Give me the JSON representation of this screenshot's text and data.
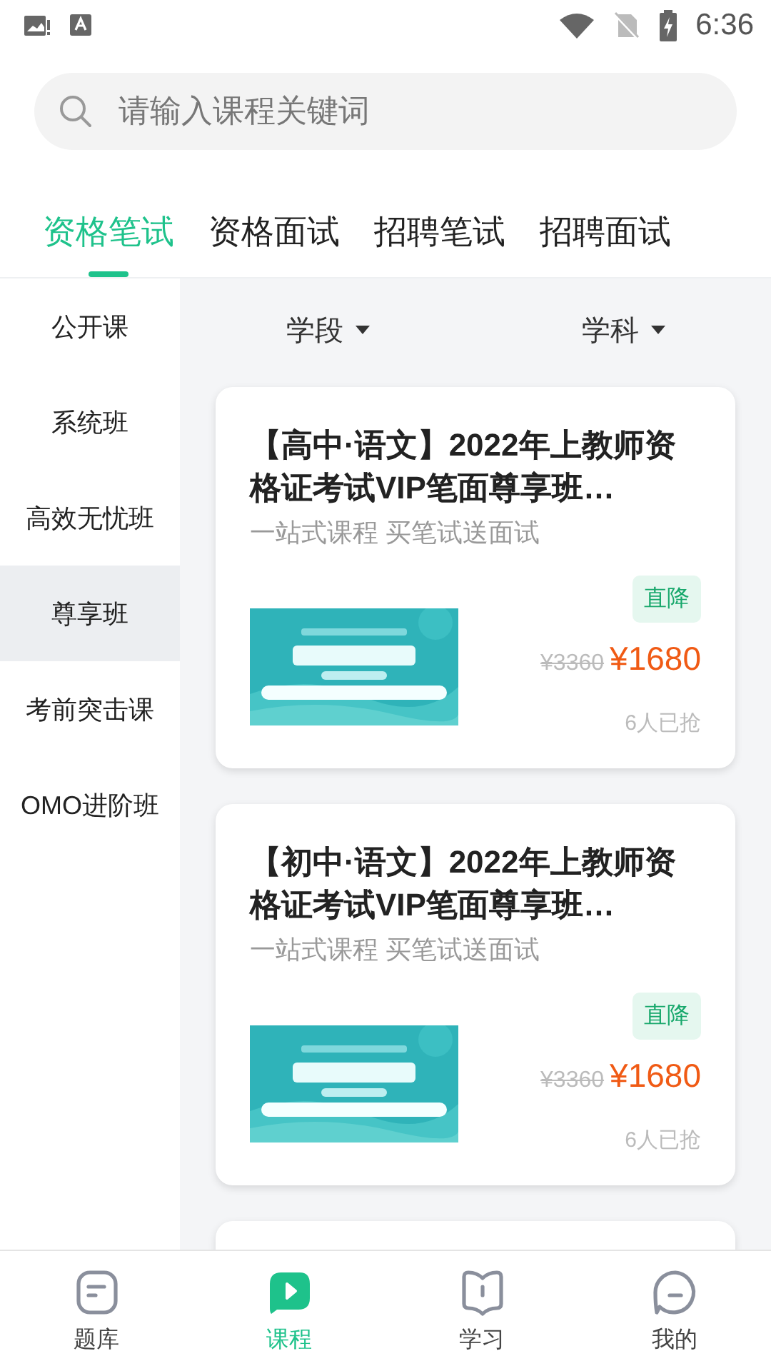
{
  "status_bar": {
    "time": "6:36"
  },
  "search": {
    "placeholder": "请输入课程关键词"
  },
  "tabs": [
    {
      "label": "资格笔试",
      "selected": true
    },
    {
      "label": "资格面试",
      "selected": false
    },
    {
      "label": "招聘笔试",
      "selected": false
    },
    {
      "label": "招聘面试",
      "selected": false
    }
  ],
  "sidebar": {
    "items": [
      {
        "label": "公开课",
        "selected": false
      },
      {
        "label": "系统班",
        "selected": false
      },
      {
        "label": "高效无忧班",
        "selected": false
      },
      {
        "label": "尊享班",
        "selected": true
      },
      {
        "label": "考前突击课",
        "selected": false
      },
      {
        "label": "OMO进阶班",
        "selected": false
      }
    ]
  },
  "filters": [
    {
      "label": "学段"
    },
    {
      "label": "学科"
    }
  ],
  "courses": [
    {
      "title": "【高中·语文】2022年上教师资格证考试VIP笔面尊享班…",
      "subtitle": "一站式课程 买笔试送面试",
      "badge": "直降",
      "original_price": "¥3360",
      "price": "¥1680",
      "sold": "6人已抢"
    },
    {
      "title": "【初中·语文】2022年上教师资格证考试VIP笔面尊享班…",
      "subtitle": "一站式课程 买笔试送面试",
      "badge": "直降",
      "original_price": "¥3360",
      "price": "¥1680",
      "sold": "6人已抢"
    }
  ],
  "bottom_nav": [
    {
      "label": "题库",
      "selected": false
    },
    {
      "label": "课程",
      "selected": true
    },
    {
      "label": "学习",
      "selected": false
    },
    {
      "label": "我的",
      "selected": false
    }
  ]
}
